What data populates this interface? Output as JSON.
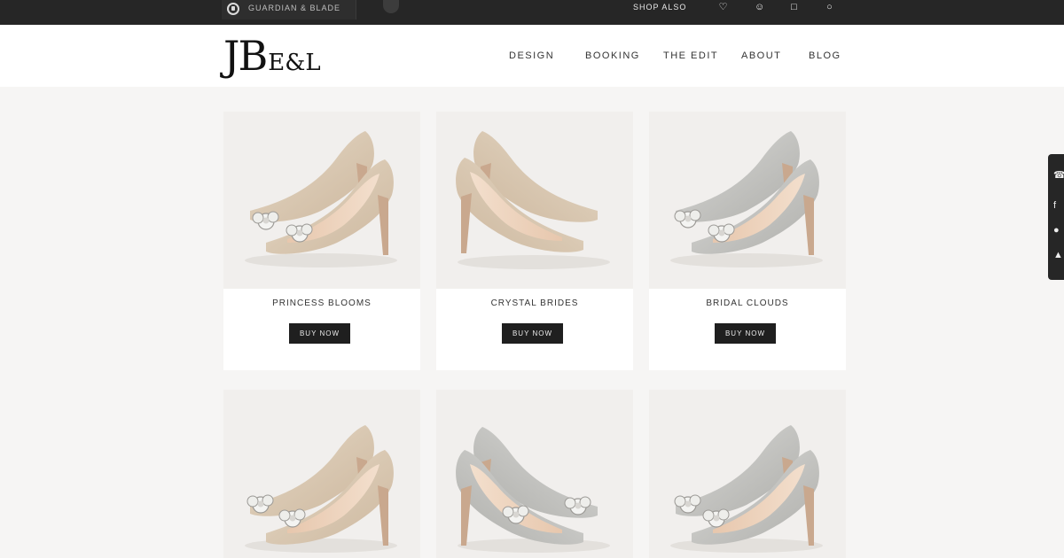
{
  "topbar": {
    "search_label": "GUARDIAN & BLADE",
    "link_label": "SHOP ALSO",
    "icons": [
      "heart-icon",
      "user-icon",
      "bag-icon",
      "search-icon"
    ]
  },
  "header": {
    "logo_big": "JB",
    "logo_small": "E&L",
    "nav": [
      "DESIGN",
      "BOOKING",
      "THE EDIT",
      "ABOUT",
      "BLOG"
    ]
  },
  "products": [
    {
      "name": "PRINCESS BLOOMS",
      "button": "BUY NOW"
    },
    {
      "name": "CRYSTAL BRIDES",
      "button": "BUY NOW"
    },
    {
      "name": "BRIDAL CLOUDS",
      "button": "BUY NOW"
    },
    {
      "name": "",
      "button": ""
    },
    {
      "name": "",
      "button": ""
    },
    {
      "name": "",
      "button": ""
    }
  ],
  "colors": {
    "topbar": "#262626",
    "button": "#1f1f1f",
    "page_bg": "#f6f5f4"
  },
  "sidebar_icons": [
    "pinterest-icon",
    "facebook-icon",
    "twitter-icon",
    "arrow-up-icon"
  ]
}
